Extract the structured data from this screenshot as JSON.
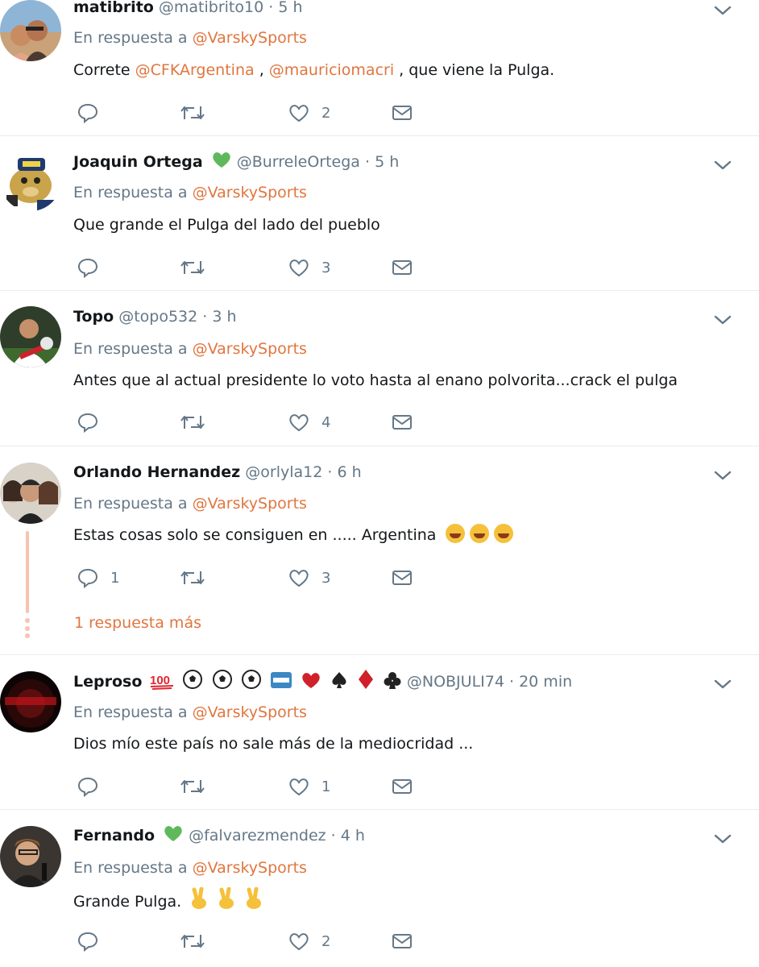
{
  "reply_prefix": "En respuesta a",
  "reply_target": "@VarskySports",
  "tweets": [
    {
      "name": "matibrito",
      "handle": "@matibrito10",
      "time": "5 h",
      "text_parts": [
        "Correte ",
        "@CFKArgentina",
        " , ",
        "@mauriciomacri",
        " , que viene la Pulga."
      ],
      "replies": "",
      "retweets": "",
      "likes": "2"
    },
    {
      "name": "Joaquin Ortega",
      "handle": "@BurreleOrtega",
      "time": "5 h",
      "text": "Que grande el Pulga del lado del pueblo",
      "replies": "",
      "retweets": "",
      "likes": "3"
    },
    {
      "name": "Topo",
      "handle": "@topo532",
      "time": "3 h",
      "text": "Antes que al actual presidente lo voto hasta al enano polvorita...crack el pulga",
      "replies": "",
      "retweets": "",
      "likes": "4"
    },
    {
      "name": "Orlando Hernandez",
      "handle": "@orlyla12",
      "time": "6 h",
      "text": "Estas cosas solo se consiguen en ..... Argentina",
      "replies": "1",
      "retweets": "",
      "likes": "3",
      "more_replies": "1 respuesta más"
    },
    {
      "name": "Leproso",
      "handle": "@NOBJULI74",
      "time": "20 min",
      "text": "Dios mío este país no sale más de la mediocridad ...",
      "replies": "",
      "retweets": "",
      "likes": "1"
    },
    {
      "name": "Fernando",
      "handle": "@falvarezmendez",
      "time": "4 h",
      "text": "Grande Pulga.",
      "replies": "",
      "retweets": "",
      "likes": "2"
    }
  ],
  "colors": {
    "mention": "#e0763f",
    "muted": "#657786",
    "heart_badge": "#5fb85c",
    "thread_line": "#f7c2b1"
  },
  "icons": [
    "reply-icon",
    "retweet-icon",
    "like-icon",
    "dm-icon",
    "chevron-down-icon",
    "green-heart-icon"
  ]
}
